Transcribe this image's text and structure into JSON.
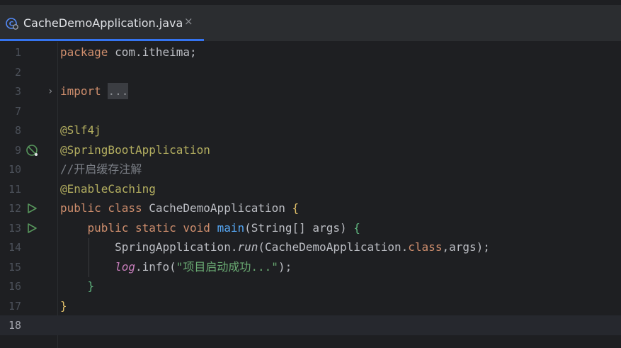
{
  "tab": {
    "filename": "CacheDemoApplication.java",
    "close": "×"
  },
  "colors": {
    "accent": "#3574f0",
    "keyword": "#cf8e6d",
    "annotation": "#b3ae60",
    "string": "#6aab73",
    "method": "#56a8f5",
    "field": "#c77dbb",
    "comment": "#7a7e85",
    "run_icon": "#57965c"
  },
  "gutter_icons": {
    "line9": "spring-bean-icon",
    "line12": "run-icon",
    "line13": "run-icon"
  },
  "lines": {
    "l1": {
      "num": "1",
      "kw": "package",
      "rest": " com.itheima;"
    },
    "l2": {
      "num": "2"
    },
    "l3": {
      "num": "3",
      "kw": "import",
      "folded": "...",
      "fold_arrow": "›"
    },
    "l7": {
      "num": "7"
    },
    "l8": {
      "num": "8",
      "ann": "@Slf4j"
    },
    "l9": {
      "num": "9",
      "ann": "@SpringBootApplication"
    },
    "l10": {
      "num": "10",
      "comment": "//开启缓存注解"
    },
    "l11": {
      "num": "11",
      "ann": "@EnableCaching"
    },
    "l12": {
      "num": "12",
      "kw": "public class",
      "name": " CacheDemoApplication ",
      "brace": "{"
    },
    "l13": {
      "num": "13",
      "indent": "    ",
      "kw": "public static void",
      "sp": " ",
      "fn": "main",
      "args": "(String[] args) ",
      "brace": "{"
    },
    "l14": {
      "num": "14",
      "indent": "        ",
      "a": "SpringApplication.",
      "fn": "run",
      "b": "(CacheDemoApplication.",
      "kw": "class",
      "c": ",args);"
    },
    "l15": {
      "num": "15",
      "indent": "        ",
      "fld": "log",
      "a": ".info(",
      "str": "\"项目启动成功...\"",
      "c": ");"
    },
    "l16": {
      "num": "16",
      "indent": "    ",
      "brace": "}"
    },
    "l17": {
      "num": "17",
      "brace": "}"
    },
    "l18": {
      "num": "18"
    }
  }
}
